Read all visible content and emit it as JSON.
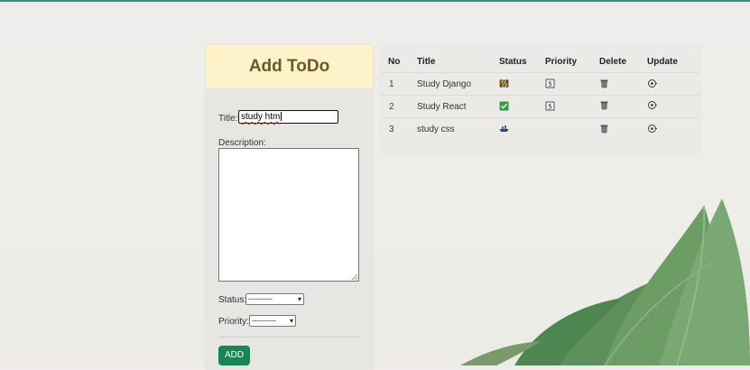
{
  "form": {
    "heading": "Add ToDo",
    "title_label": "Title:",
    "title_value": "study htm",
    "description_label": "Description:",
    "status_label": "Status:",
    "status_selected": "---------",
    "priority_label": "Priority:",
    "priority_selected": "---------",
    "add_label": "ADD"
  },
  "table": {
    "headers": [
      "No",
      "Title",
      "Status",
      "Priority",
      "Delete",
      "Update"
    ],
    "rows": [
      {
        "no": "1",
        "title": "Study Django",
        "status_icon": "construction-icon",
        "priority_icon": "priority-5-icon",
        "delete_icon": "trash-icon",
        "update_icon": "update-icon"
      },
      {
        "no": "2",
        "title": "Study React",
        "status_icon": "check-icon",
        "priority_icon": "priority-5-icon",
        "delete_icon": "trash-icon",
        "update_icon": "update-icon"
      },
      {
        "no": "3",
        "title": "study css",
        "status_icon": "ship-icon",
        "priority_icon": "",
        "delete_icon": "trash-icon",
        "update_icon": "update-icon"
      }
    ]
  },
  "colors": {
    "accent": "#198754",
    "header_bg": "#fdf2c9",
    "header_text": "#6a5a2b"
  }
}
